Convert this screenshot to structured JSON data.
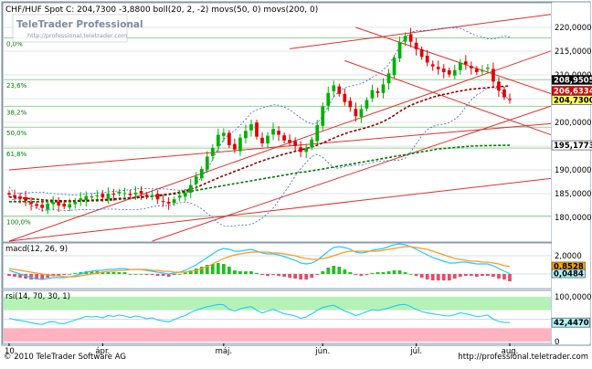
{
  "chart_data": [
    {
      "type": "candlestick",
      "title": "CHF/HUF Spot C: 204,7300 -3,8800 boll(20, 2, -2) movs(50, 0) movs(200, 0)",
      "watermark_title": "TeleTrader Professional",
      "watermark_url": "http://professional.teletrader.com",
      "ylim": [
        175,
        225
      ],
      "y_ticks": [
        180000,
        185000,
        190000,
        195000,
        200000,
        205000,
        210000,
        215000,
        220000
      ],
      "y_tick_labels": [
        "180,0000",
        "185,0000",
        "190,0000",
        "195,0000",
        "200,0000",
        "205,0000",
        "210,0000",
        "215,0000",
        "220,0000"
      ],
      "x_labels": [
        "10",
        "ápr.",
        "máj.",
        "jún.",
        "júl.",
        "aug."
      ],
      "fib_levels": [
        {
          "label": "0,0%",
          "value": 217.8
        },
        {
          "label": "23,6%",
          "value": 209.0
        },
        {
          "label": "38,2%",
          "value": 203.4
        },
        {
          "label": "50,0%",
          "value": 199.0
        },
        {
          "label": "61,8%",
          "value": 194.6
        },
        {
          "label": "100,0%",
          "value": 180.3
        }
      ],
      "value_labels": [
        {
          "label": "208,9505",
          "value": 208.95,
          "color": "#ffffff",
          "bg": "#000000"
        },
        {
          "label": "206,6334",
          "value": 206.63,
          "color": "#ffffff",
          "bg": "#dd0000"
        },
        {
          "label": "204,7300",
          "value": 204.73,
          "color": "#000000",
          "bg": "#ffff66"
        },
        {
          "label": "195,1773",
          "value": 195.18,
          "color": "#000000",
          "bg": "#ffffff"
        }
      ],
      "closes": [
        184.8,
        184.3,
        183.9,
        183.5,
        182.8,
        182.4,
        182.0,
        182.9,
        183.2,
        182.5,
        182.3,
        182.8,
        183.3,
        184.0,
        184.5,
        184.4,
        184.6,
        184.2,
        185.0,
        184.8,
        185.4,
        185.1,
        184.7,
        185.2,
        185.0,
        184.4,
        184.7,
        183.8,
        183.4,
        182.9,
        183.8,
        184.6,
        185.2,
        186.8,
        188.6,
        190.2,
        192.8,
        194.6,
        197.4,
        197.8,
        195.2,
        194.3,
        196.8,
        198.2,
        199.6,
        197.0,
        195.6,
        197.2,
        198.6,
        197.4,
        196.2,
        195.7,
        195.0,
        193.8,
        194.5,
        196.4,
        199.4,
        203.4,
        206.2,
        207.8,
        206.0,
        204.3,
        203.2,
        201.3,
        202.8,
        204.7,
        206.8,
        206.2,
        208.0,
        210.3,
        213.6,
        216.9,
        218.2,
        217.0,
        215.4,
        213.8,
        212.6,
        211.8,
        211.2,
        210.6,
        210.1,
        211.0,
        212.6,
        212.2,
        211.4,
        210.6,
        210.9,
        211.5,
        208.6,
        206.7,
        205.3,
        204.73
      ],
      "ma50": [
        184.3,
        184.2,
        184.1,
        184.0,
        183.9,
        183.8,
        183.7,
        183.6,
        183.6,
        183.5,
        183.5,
        183.5,
        183.5,
        183.5,
        183.6,
        183.6,
        183.7,
        183.7,
        183.8,
        183.9,
        184.0,
        184.0,
        184.1,
        184.2,
        184.3,
        184.4,
        184.5,
        184.6,
        184.8,
        184.9,
        185.1,
        185.3,
        185.6,
        185.9,
        186.3,
        186.8,
        187.3,
        187.8,
        188.3,
        188.8,
        189.2,
        189.7,
        190.1,
        190.6,
        191.0,
        191.5,
        191.9,
        192.3,
        192.6,
        193.0,
        193.3,
        193.6,
        193.9,
        194.2,
        194.5,
        194.8,
        195.2,
        195.7,
        196.2,
        196.7,
        197.2,
        197.6,
        198.0,
        198.3,
        198.6,
        198.9,
        199.3,
        199.7,
        200.2,
        200.8,
        201.5,
        202.3,
        203.0,
        203.6,
        204.1,
        204.5,
        204.9,
        205.3,
        205.6,
        205.9,
        206.1,
        206.4,
        206.6,
        206.8,
        207.0,
        207.1,
        207.2,
        207.3,
        207.4,
        207.5,
        207.6,
        207.7
      ],
      "ma200": [
        183.3,
        183.3,
        183.3,
        183.3,
        183.3,
        183.3,
        183.3,
        183.3,
        183.3,
        183.3,
        183.3,
        183.3,
        183.4,
        183.4,
        183.4,
        183.5,
        183.5,
        183.6,
        183.6,
        183.7,
        183.8,
        183.9,
        184.0,
        184.1,
        184.2,
        184.3,
        184.4,
        184.5,
        184.6,
        184.8,
        184.9,
        185.1,
        185.3,
        185.5,
        185.7,
        185.9,
        186.1,
        186.3,
        186.5,
        186.7,
        186.9,
        187.1,
        187.3,
        187.5,
        187.7,
        187.9,
        188.1,
        188.3,
        188.5,
        188.7,
        188.9,
        189.1,
        189.3,
        189.5,
        189.6,
        189.8,
        190.0,
        190.2,
        190.4,
        190.6,
        190.8,
        191.0,
        191.2,
        191.4,
        191.6,
        191.8,
        192.0,
        192.2,
        192.4,
        192.6,
        192.8,
        193.0,
        193.2,
        193.4,
        193.6,
        193.8,
        194.0,
        194.2,
        194.4,
        194.5,
        194.6,
        194.7,
        194.8,
        194.9,
        195.0,
        195.05,
        195.1,
        195.12,
        195.14,
        195.16,
        195.17,
        195.18
      ],
      "channel_lines": [
        {
          "from": [
            0,
            175.0
          ],
          "to": [
            91,
            212.0
          ]
        },
        {
          "from": [
            26,
            175.0
          ],
          "to": [
            91,
            200.5
          ]
        },
        {
          "from": [
            0,
            190.0
          ],
          "to": [
            91,
            199.0
          ]
        },
        {
          "from": [
            0,
            175.0
          ],
          "to": [
            91,
            187.2
          ]
        },
        {
          "from": [
            51,
            215.5
          ],
          "to": [
            91,
            221.6
          ]
        },
        {
          "from": [
            63,
            220.0
          ],
          "to": [
            91,
            209.0
          ]
        },
        {
          "from": [
            61,
            213.0
          ],
          "to": [
            91,
            200.5
          ]
        }
      ]
    },
    {
      "type": "histogram",
      "title": "macd(12, 26, 9)",
      "ylim": [
        -1.5,
        3.2
      ],
      "y_ticks": [
        0,
        2
      ],
      "y_tick_labels": [
        "0",
        "2,0000"
      ],
      "value_labels": [
        {
          "label": "0,8528",
          "value": 0.85,
          "color": "#000000",
          "bg": "#ffa500"
        },
        {
          "label": "0,0484",
          "value": 0.05,
          "color": "#000000",
          "bg": "#aef5ff"
        }
      ],
      "macd": [
        0.4,
        0.2,
        0.0,
        -0.2,
        -0.4,
        -0.5,
        -0.6,
        -0.5,
        -0.4,
        -0.4,
        -0.4,
        -0.3,
        -0.2,
        0.0,
        0.2,
        0.3,
        0.4,
        0.4,
        0.5,
        0.5,
        0.6,
        0.6,
        0.5,
        0.5,
        0.5,
        0.4,
        0.3,
        0.2,
        0.1,
        0.0,
        0.1,
        0.2,
        0.4,
        0.7,
        1.0,
        1.4,
        1.8,
        2.2,
        2.6,
        2.8,
        2.7,
        2.5,
        2.5,
        2.6,
        2.7,
        2.5,
        2.3,
        2.2,
        2.2,
        2.1,
        1.9,
        1.7,
        1.5,
        1.2,
        1.1,
        1.2,
        1.5,
        2.0,
        2.5,
        2.9,
        3.0,
        2.9,
        2.7,
        2.4,
        2.3,
        2.4,
        2.6,
        2.7,
        2.8,
        3.0,
        3.2,
        3.3,
        3.2,
        3.0,
        2.7,
        2.4,
        2.1,
        1.8,
        1.6,
        1.4,
        1.2,
        1.2,
        1.3,
        1.3,
        1.2,
        1.1,
        1.1,
        1.1,
        0.9,
        0.6,
        0.3,
        0.05
      ],
      "signal": [
        0.6,
        0.5,
        0.4,
        0.3,
        0.2,
        0.1,
        0.0,
        -0.1,
        -0.2,
        -0.2,
        -0.3,
        -0.3,
        -0.3,
        -0.2,
        -0.1,
        0.0,
        0.1,
        0.2,
        0.3,
        0.3,
        0.4,
        0.4,
        0.5,
        0.5,
        0.5,
        0.5,
        0.4,
        0.4,
        0.3,
        0.3,
        0.2,
        0.2,
        0.2,
        0.3,
        0.4,
        0.6,
        0.8,
        1.1,
        1.4,
        1.7,
        1.9,
        2.1,
        2.2,
        2.3,
        2.4,
        2.4,
        2.4,
        2.4,
        2.3,
        2.3,
        2.2,
        2.1,
        2.0,
        1.8,
        1.7,
        1.6,
        1.6,
        1.7,
        1.8,
        2.0,
        2.2,
        2.4,
        2.5,
        2.5,
        2.5,
        2.5,
        2.5,
        2.5,
        2.6,
        2.7,
        2.8,
        2.9,
        3.0,
        3.0,
        2.9,
        2.8,
        2.7,
        2.5,
        2.3,
        2.1,
        1.9,
        1.7,
        1.6,
        1.5,
        1.4,
        1.4,
        1.3,
        1.3,
        1.2,
        1.1,
        0.9,
        0.85
      ],
      "hist": [
        -0.2,
        -0.3,
        -0.4,
        -0.5,
        -0.6,
        -0.6,
        -0.6,
        -0.4,
        -0.2,
        -0.2,
        -0.1,
        0.0,
        0.1,
        0.2,
        0.3,
        0.3,
        0.3,
        0.2,
        0.2,
        0.2,
        0.2,
        0.2,
        0.0,
        0.0,
        0.0,
        -0.1,
        -0.1,
        -0.2,
        -0.2,
        -0.3,
        -0.1,
        0.0,
        0.2,
        0.4,
        0.6,
        0.8,
        1.0,
        1.1,
        1.2,
        1.1,
        0.8,
        0.4,
        0.3,
        0.3,
        0.3,
        0.1,
        -0.1,
        -0.2,
        -0.1,
        -0.2,
        -0.3,
        -0.4,
        -0.5,
        -0.6,
        -0.6,
        -0.4,
        -0.1,
        0.3,
        0.7,
        0.9,
        0.8,
        0.5,
        0.2,
        -0.1,
        -0.2,
        -0.1,
        0.1,
        0.2,
        0.2,
        0.3,
        0.4,
        0.4,
        0.2,
        0.0,
        -0.2,
        -0.4,
        -0.6,
        -0.7,
        -0.7,
        -0.7,
        -0.7,
        -0.5,
        -0.3,
        -0.2,
        -0.2,
        -0.3,
        -0.2,
        -0.2,
        -0.3,
        -0.5,
        -0.6,
        -0.8
      ]
    },
    {
      "type": "line",
      "title": "rsi(14, 70, 30, 1)",
      "ylim": [
        0,
        110
      ],
      "y_ticks": [
        0,
        100
      ],
      "y_tick_labels": [
        "0",
        "100,0000"
      ],
      "overbought": 70,
      "oversold": 30,
      "value_labels": [
        {
          "label": "42,4470",
          "value": 42.45,
          "color": "#000000",
          "bg": "#aef5ff"
        }
      ],
      "values": [
        52,
        49,
        47,
        45,
        42,
        40,
        38,
        43,
        45,
        41,
        40,
        44,
        48,
        52,
        56,
        55,
        56,
        53,
        58,
        56,
        59,
        57,
        54,
        57,
        55,
        51,
        53,
        48,
        46,
        44,
        49,
        54,
        58,
        65,
        70,
        74,
        78,
        80,
        83,
        82,
        72,
        68,
        73,
        76,
        78,
        70,
        64,
        68,
        72,
        67,
        62,
        60,
        57,
        52,
        55,
        62,
        70,
        76,
        79,
        81,
        75,
        68,
        64,
        58,
        62,
        67,
        71,
        69,
        72,
        75,
        79,
        82,
        83,
        78,
        72,
        67,
        64,
        62,
        60,
        58,
        57,
        60,
        64,
        62,
        59,
        56,
        57,
        59,
        50,
        45,
        43,
        42.45
      ]
    }
  ],
  "footer": {
    "copyright": "© 2010 TeleTrader Software AG",
    "url": "http://professional.teletrader.com"
  }
}
